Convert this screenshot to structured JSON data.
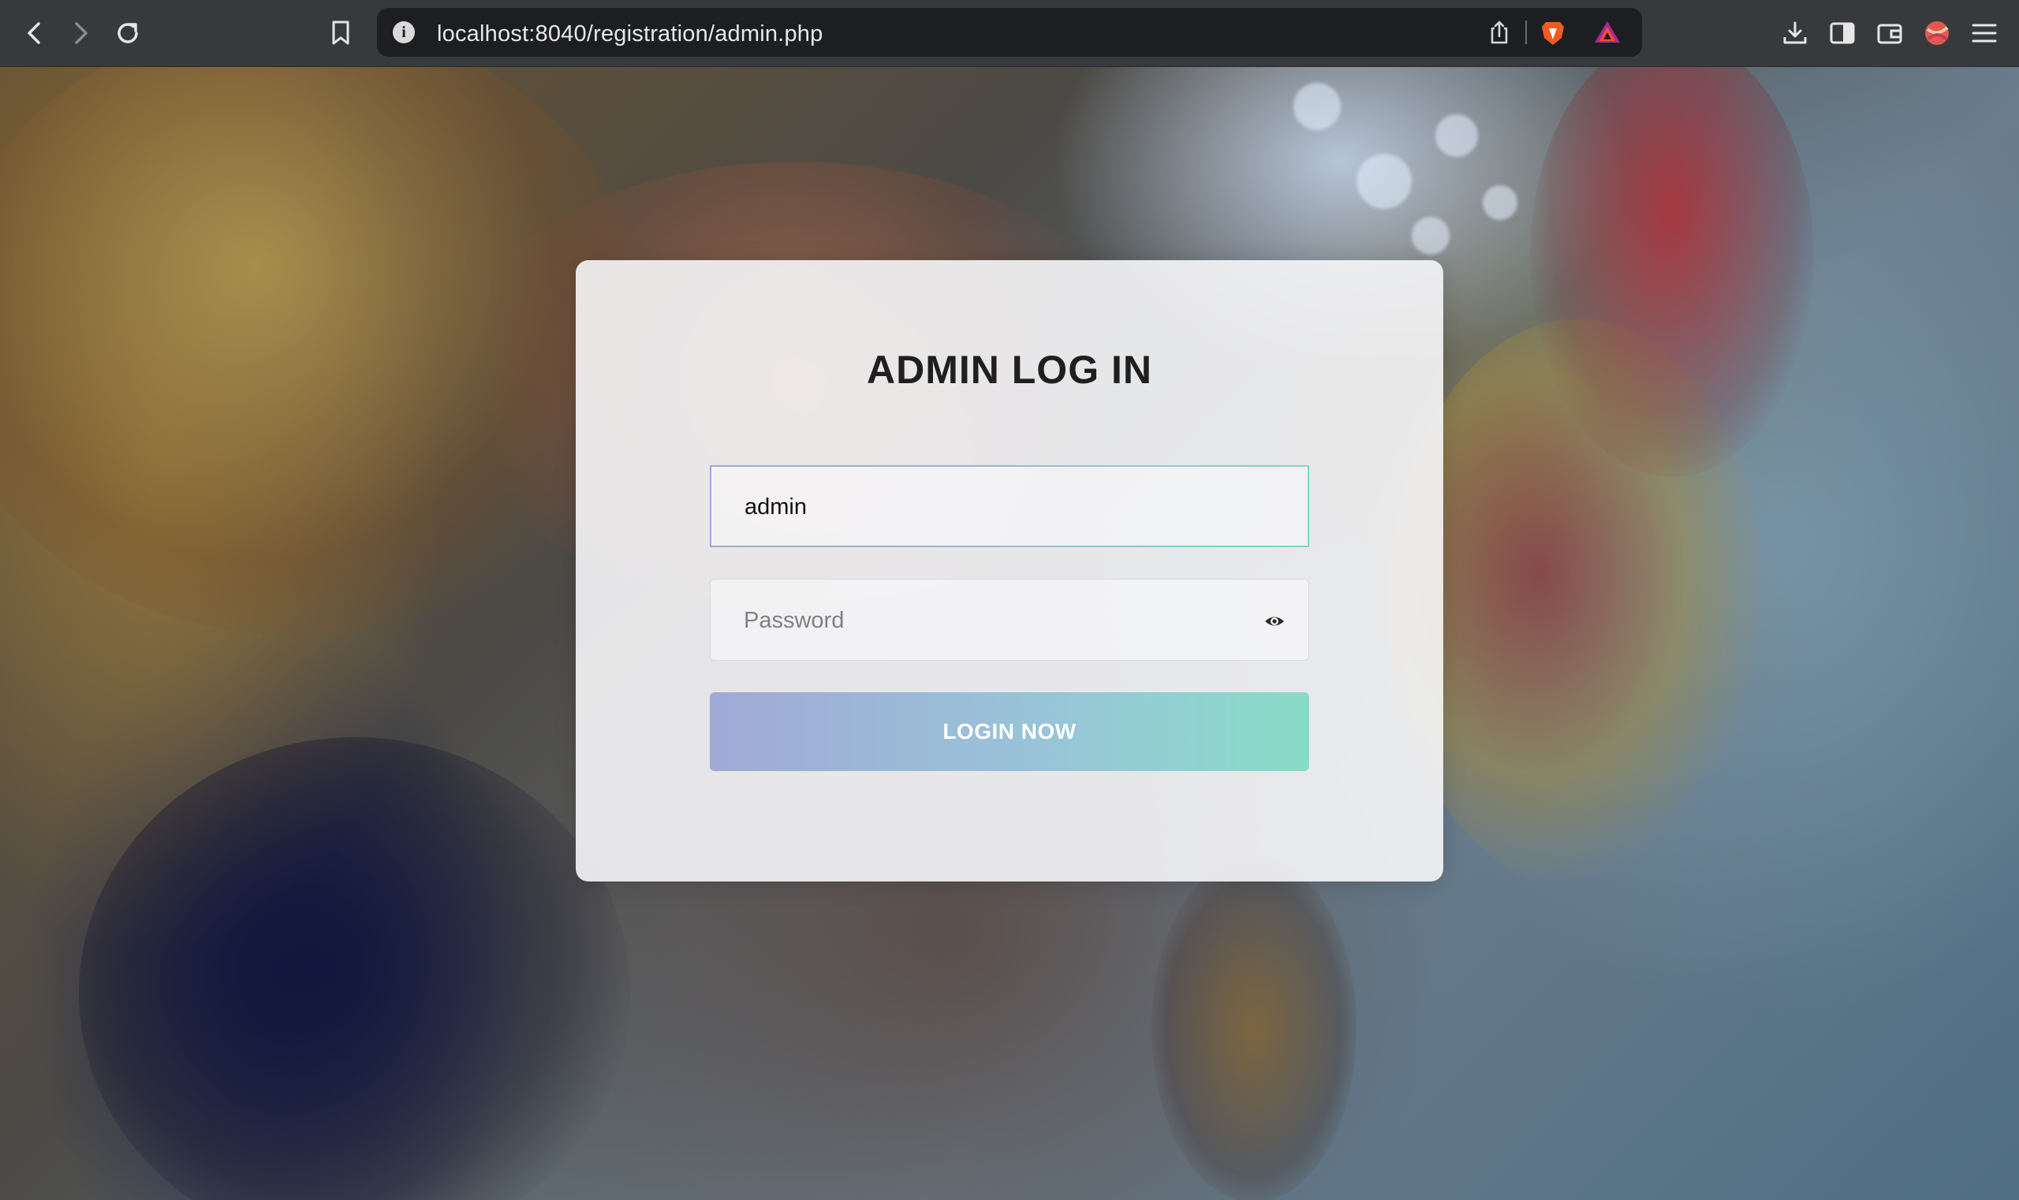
{
  "browser": {
    "url": "localhost:8040/registration/admin.php"
  },
  "login": {
    "title": "ADMIN LOG IN",
    "username_value": "admin",
    "password_placeholder": "Password",
    "login_button": "LOGIN NOW"
  },
  "colors": {
    "button_gradient_start": "#a1a9d6",
    "button_gradient_end": "#88dcc8",
    "title": "#1f1f1f"
  },
  "icons": [
    "back-icon",
    "forward-icon",
    "reload-icon",
    "bookmark-icon",
    "site-info-icon",
    "share-icon",
    "brave-shields-icon",
    "brave-rewards-icon",
    "download-icon",
    "sidebar-icon",
    "wallet-icon",
    "profile-icon",
    "menu-icon",
    "eye-icon"
  ]
}
